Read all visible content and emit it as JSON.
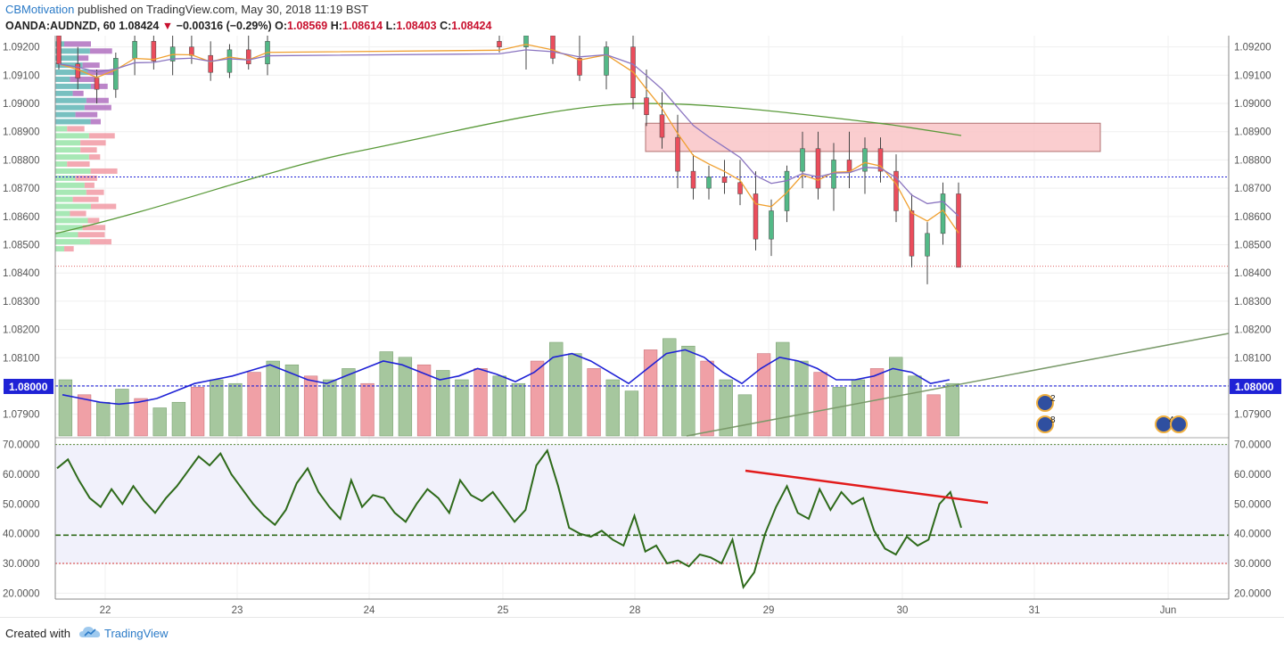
{
  "header": {
    "author": "CBMotivation",
    "published": "published on TradingView.com, May 30, 2018 11:19 BST",
    "symbol": "OANDA:AUDNZD, 60",
    "last": "1.08424",
    "change": "−0.00316 (−0.29%)",
    "open_label": "O:",
    "open": "1.08569",
    "high_label": "H:",
    "high": "1.08614",
    "low_label": "L:",
    "low": "1.08403",
    "close_label": "C:",
    "close": "1.08424"
  },
  "footer": {
    "created_with": "Created with",
    "brand": "TradingView"
  },
  "colors": {
    "up": "#53b987",
    "down": "#eb4d5c",
    "ema_fast": "#f0a030",
    "ema_mid": "#8a74c0",
    "ema_long": "#5a9a3a",
    "rsi": "#2e6a1a",
    "vol_ma": "#1f22d6",
    "level": "#1f22d6"
  },
  "chart_data": [
    {
      "type": "candlestick",
      "x_tick_labels": [
        "22",
        "23",
        "24",
        "25",
        "28",
        "29",
        "30",
        "31",
        "Jun"
      ],
      "y_tick_labels": [
        "1.09200",
        "1.09100",
        "1.09000",
        "1.08900",
        "1.08800",
        "1.08700",
        "1.08600",
        "1.08500",
        "1.08400",
        "1.08300",
        "1.08200",
        "1.08100",
        "1.08000",
        "1.07900"
      ],
      "ylim": [
        1.0782,
        1.0924
      ],
      "level_line": 1.08,
      "level_label": "1.08000",
      "dotted_level": 1.0874,
      "last_price": 1.08424,
      "supply_zone": {
        "from_date": "28",
        "to_date": "31",
        "low": 1.0883,
        "high": 1.0893
      },
      "candles_approx": [
        [
          1.0924,
          1.0926,
          1.0912,
          1.0914
        ],
        [
          1.0914,
          1.092,
          1.0905,
          1.0909
        ],
        [
          1.0909,
          1.0912,
          1.09,
          1.0905
        ],
        [
          1.0905,
          1.0918,
          1.0902,
          1.0916
        ],
        [
          1.0916,
          1.0926,
          1.091,
          1.0922
        ],
        [
          1.0922,
          1.0926,
          1.0912,
          1.0915
        ],
        [
          1.0915,
          1.0924,
          1.091,
          1.092
        ],
        [
          1.092,
          1.0926,
          1.0914,
          1.0917
        ],
        [
          1.0917,
          1.0922,
          1.0908,
          1.0911
        ],
        [
          1.0911,
          1.0921,
          1.0909,
          1.0919
        ],
        [
          1.0919,
          1.0926,
          1.0912,
          1.0914
        ],
        [
          1.0914,
          1.0924,
          1.091,
          1.0922
        ],
        [
          1.0922,
          1.0926,
          1.0918,
          1.092
        ],
        [
          1.092,
          1.0926,
          1.0912,
          1.0924
        ],
        [
          1.0924,
          1.0926,
          1.0914,
          1.0916
        ],
        [
          1.0916,
          1.0926,
          1.0908,
          1.091
        ],
        [
          1.091,
          1.0922,
          1.0905,
          1.092
        ],
        [
          1.092,
          1.0926,
          1.0898,
          1.0902
        ],
        [
          1.0902,
          1.0912,
          1.0892,
          1.0896
        ],
        [
          1.0896,
          1.0904,
          1.0884,
          1.0888
        ],
        [
          1.0888,
          1.0896,
          1.087,
          1.0876
        ],
        [
          1.0876,
          1.0882,
          1.0866,
          1.087
        ],
        [
          1.087,
          1.0878,
          1.0866,
          1.0874
        ],
        [
          1.0874,
          1.088,
          1.0868,
          1.0872
        ],
        [
          1.0872,
          1.088,
          1.0864,
          1.0868
        ],
        [
          1.0868,
          1.0876,
          1.0848,
          1.0852
        ],
        [
          1.0852,
          1.0866,
          1.0846,
          1.0862
        ],
        [
          1.0862,
          1.0878,
          1.0858,
          1.0876
        ],
        [
          1.0876,
          1.089,
          1.087,
          1.0884
        ],
        [
          1.0884,
          1.089,
          1.0866,
          1.087
        ],
        [
          1.087,
          1.0886,
          1.0862,
          1.088
        ],
        [
          1.088,
          1.089,
          1.087,
          1.0876
        ],
        [
          1.0876,
          1.0888,
          1.0868,
          1.0884
        ],
        [
          1.0884,
          1.0888,
          1.0872,
          1.0876
        ],
        [
          1.0876,
          1.0882,
          1.0858,
          1.0862
        ],
        [
          1.0862,
          1.0868,
          1.0842,
          1.0846
        ],
        [
          1.0846,
          1.0858,
          1.0836,
          1.0854
        ],
        [
          1.0854,
          1.0872,
          1.085,
          1.0868
        ],
        [
          1.0868,
          1.0872,
          1.0844,
          1.0842
        ]
      ]
    },
    {
      "type": "bar",
      "name": "",
      "values_approx": [
        30,
        22,
        18,
        25,
        20,
        15,
        18,
        26,
        30,
        28,
        34,
        40,
        38,
        32,
        30,
        36,
        28,
        45,
        42,
        38,
        35,
        30,
        36,
        32,
        28,
        40,
        50,
        44,
        36,
        30,
        24,
        46,
        52,
        48,
        40,
        30,
        22,
        44,
        50,
        40,
        34,
        26,
        30,
        36,
        42,
        32,
        22,
        28
      ],
      "ma_approx": [
        22,
        20,
        18,
        17,
        18,
        20,
        24,
        28,
        30,
        32,
        35,
        38,
        34,
        30,
        28,
        32,
        36,
        40,
        38,
        34,
        30,
        32,
        36,
        33,
        29,
        34,
        42,
        44,
        40,
        34,
        28,
        36,
        44,
        46,
        42,
        34,
        28,
        36,
        42,
        40,
        36,
        30,
        30,
        32,
        36,
        34,
        28,
        30
      ]
    },
    {
      "type": "line",
      "y_tick_labels": [
        "70.0000",
        "60.0000",
        "50.0000",
        "40.0000",
        "30.0000",
        "20.0000"
      ],
      "ylim": [
        18,
        72
      ],
      "overbought": 70,
      "oversold": 30,
      "reference": 39.5,
      "values_approx": [
        62,
        65,
        58,
        52,
        49,
        55,
        50,
        56,
        51,
        47,
        52,
        56,
        61,
        66,
        63,
        67,
        60,
        55,
        50,
        46,
        43,
        48,
        57,
        62,
        54,
        49,
        45,
        58,
        49,
        53,
        52,
        47,
        44,
        50,
        55,
        52,
        47,
        58,
        53,
        51,
        54,
        49,
        44,
        48,
        63,
        68,
        56,
        42,
        40,
        39,
        41,
        38,
        36,
        46,
        34,
        36,
        30,
        31,
        29,
        33,
        32,
        30,
        38,
        22,
        27,
        40,
        49,
        56,
        47,
        45,
        55,
        48,
        54,
        50,
        52,
        41,
        35,
        33,
        39,
        36,
        38,
        50,
        54,
        42
      ]
    }
  ]
}
